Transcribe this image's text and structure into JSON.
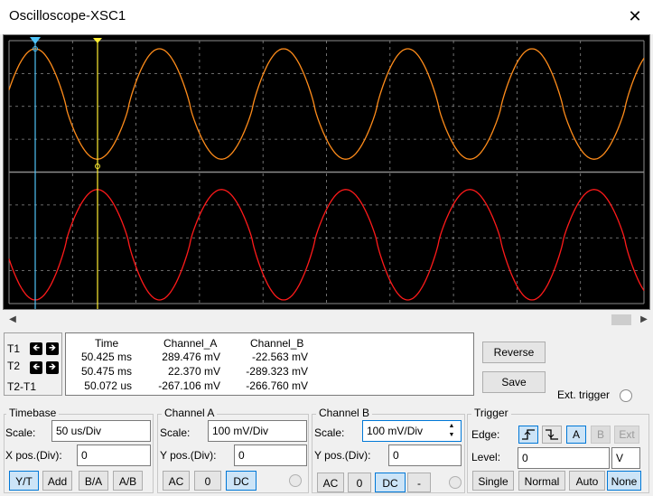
{
  "window": {
    "title": "Oscilloscope-XSC1",
    "close_glyph": "✕"
  },
  "screen": {
    "background": "#000000",
    "grid_color": "#8c8c8c",
    "channel_a_color": "#ff8c1a",
    "channel_b_color": "#ff1a1a",
    "cursor1_color": "#4fc3f7",
    "cursor2_color": "#ffee33"
  },
  "scrollbar": {
    "left_glyph": "◀",
    "right_glyph": "▶"
  },
  "cursors": {
    "t1": "T1",
    "t2": "T2",
    "t2t1": "T2-T1",
    "left_glyph": "🡸",
    "right_glyph": "🡺"
  },
  "readout": {
    "headers": [
      "Time",
      "Channel_A",
      "Channel_B"
    ],
    "rows": [
      [
        "50.425 ms",
        "289.476 mV",
        "-22.563 mV"
      ],
      [
        "50.475 ms",
        "22.370 mV",
        "-289.323 mV"
      ],
      [
        "50.072 us",
        "-267.106 mV",
        "-266.760 mV"
      ]
    ]
  },
  "actions": {
    "reverse": "Reverse",
    "save": "Save",
    "ext_trigger": "Ext. trigger"
  },
  "timebase": {
    "title": "Timebase",
    "scale_label": "Scale:",
    "scale": "50 us/Div",
    "xpos_label": "X pos.(Div):",
    "xpos": "0",
    "modes": [
      "Y/T",
      "Add",
      "B/A",
      "A/B"
    ]
  },
  "channel_a": {
    "title": "Channel A",
    "scale_label": "Scale:",
    "scale": "100 mV/Div",
    "ypos_label": "Y pos.(Div):",
    "ypos": "0",
    "coupling": [
      "AC",
      "0",
      "DC"
    ]
  },
  "channel_b": {
    "title": "Channel B",
    "scale_label": "Scale:",
    "scale": "100 mV/Div",
    "ypos_label": "Y pos.(Div):",
    "ypos": "0",
    "coupling": [
      "AC",
      "0",
      "DC",
      "-"
    ]
  },
  "trigger": {
    "title": "Trigger",
    "edge_label": "Edge:",
    "rise_glyph": "⎍",
    "fall_glyph": "⎍",
    "sources": [
      "A",
      "B",
      "Ext"
    ],
    "level_label": "Level:",
    "level": "0",
    "unit": "V",
    "modes": [
      "Single",
      "Normal",
      "Auto",
      "None"
    ]
  }
}
